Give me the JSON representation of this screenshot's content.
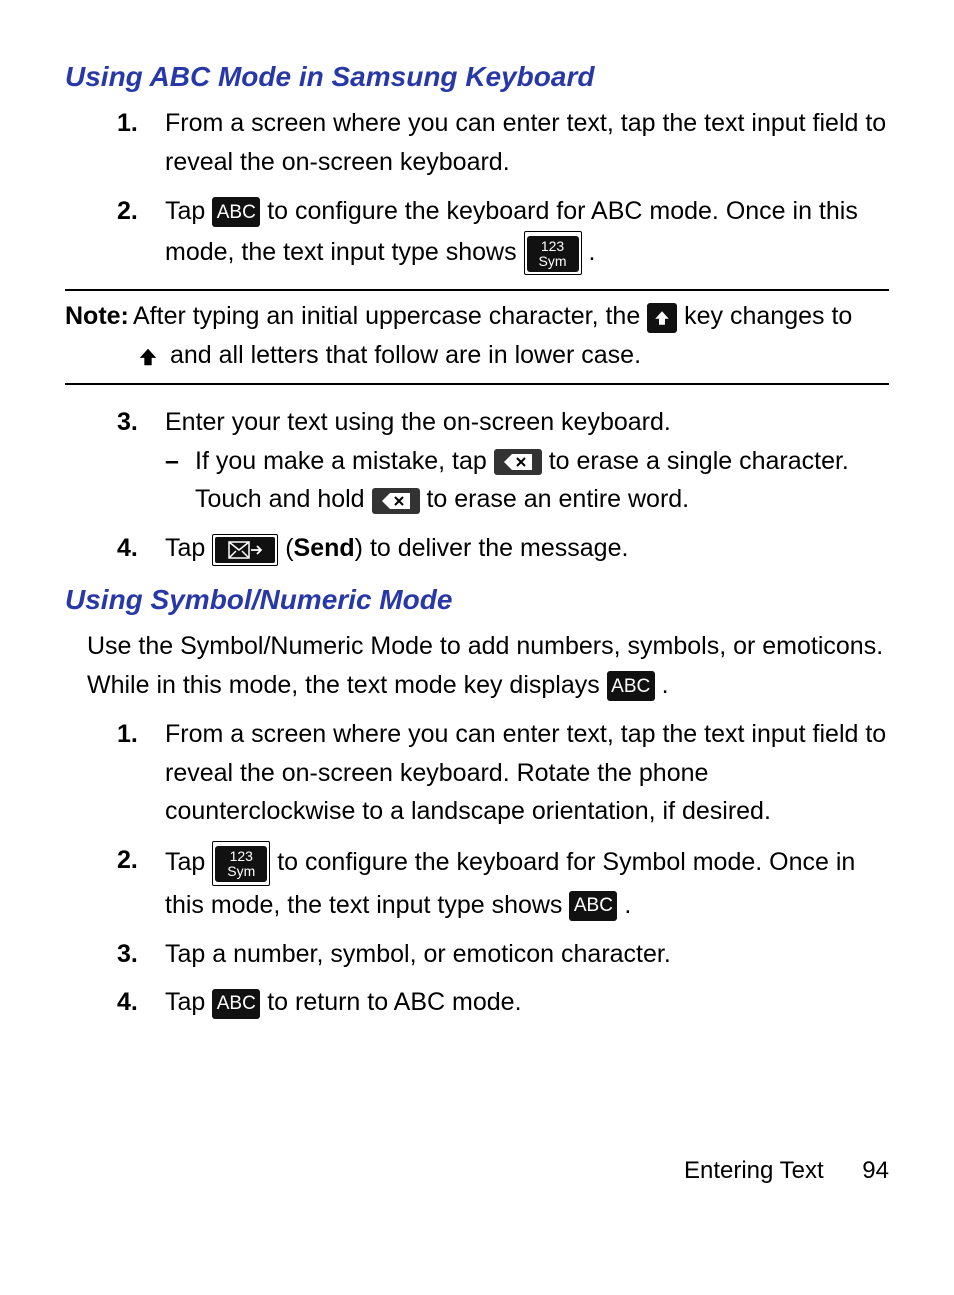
{
  "section1": {
    "heading": "Using ABC Mode in Samsung Keyboard",
    "step1": "From a screen where you can enter text, tap the text input field to reveal the on-screen keyboard.",
    "step2a": "Tap ",
    "key_abc": "ABC",
    "step2b": " to configure the keyboard for ABC mode. Once in this mode, the text input type shows ",
    "key_sym_top": "123",
    "key_sym_bot": "Sym",
    "step2c": " .",
    "note_label": "Note:",
    "note_a": " After typing an initial uppercase character, the ",
    "note_b": " key changes to ",
    "note_c": " and all letters that follow are in lower case.",
    "step3": "Enter your text using the on-screen keyboard.",
    "sub3a": "If you make a mistake, tap ",
    "sub3b": " to erase a single character. Touch and hold ",
    "sub3c": " to erase an entire word.",
    "step4a": "Tap ",
    "send_label": "Send",
    "step4b": ") to deliver the message."
  },
  "section2": {
    "heading": "Using Symbol/Numeric Mode",
    "intro_a": "Use the Symbol/Numeric Mode to add numbers, symbols, or emoticons. While in this mode, the text mode key displays ",
    "intro_b": " .",
    "step1": "From a screen where you can enter text, tap the text input field to reveal the on-screen keyboard. Rotate the phone counterclockwise to a landscape orientation, if desired.",
    "step2a": "Tap ",
    "step2b": " to configure the keyboard for Symbol mode. Once in this mode, the text input type shows ",
    "step2c": " .",
    "step3": "Tap a number, symbol, or emoticon character.",
    "step4a": "Tap ",
    "step4b": " to return to ABC mode."
  },
  "icons": {
    "abc": "ABC",
    "sym_top": "123",
    "sym_bot": "Sym"
  },
  "numbers": {
    "n1": "1.",
    "n2": "2.",
    "n3": "3.",
    "n4": "4."
  },
  "dash": "–",
  "paren_open": " (",
  "footer": {
    "section": "Entering Text",
    "page": "94"
  }
}
